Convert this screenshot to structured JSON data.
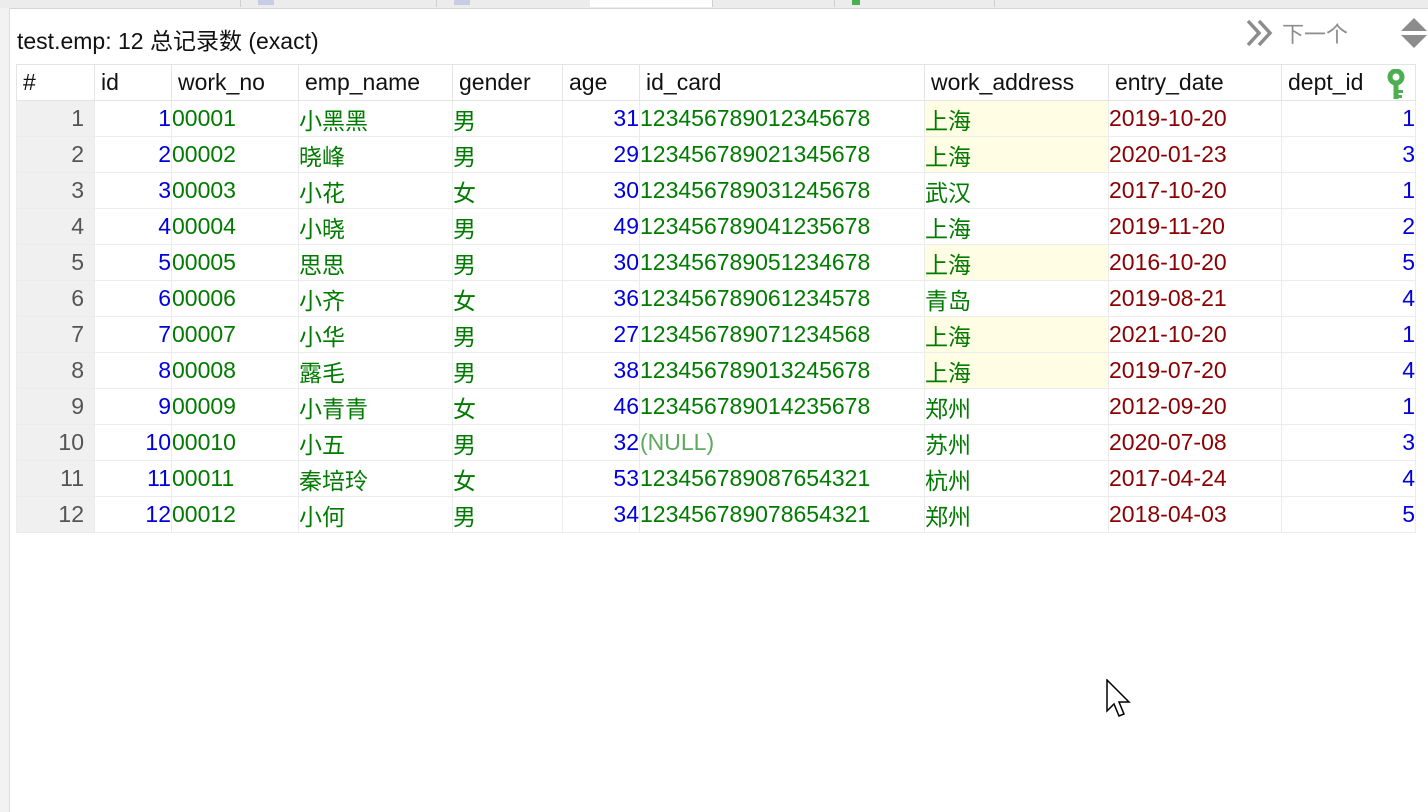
{
  "title": "test.emp: 12 总记录数 (exact)",
  "nav": {
    "next_label": "下一个",
    "next_icon": "double-chevron-right-icon",
    "updown_icon": "scroll-up-down-icon"
  },
  "columns": [
    "#",
    "id",
    "work_no",
    "emp_name",
    "gender",
    "age",
    "id_card",
    "work_address",
    "entry_date",
    "dept_id"
  ],
  "primary_key_icon": "key-icon",
  "colors": {
    "numeric": "#0000dd",
    "text": "#007b00",
    "date": "#8b0000",
    "null": "#5fa85f",
    "highlight": "#fffde3",
    "key": "#4caf50"
  },
  "rows": [
    {
      "n": "1",
      "id": "1",
      "work_no": "00001",
      "emp_name": "小黑黑",
      "gender": "男",
      "age": "31",
      "id_card": "123456789012345678",
      "work_address": "上海",
      "entry_date": "2019-10-20",
      "dept_id": "1"
    },
    {
      "n": "2",
      "id": "2",
      "work_no": "00002",
      "emp_name": "晓峰",
      "gender": "男",
      "age": "29",
      "id_card": "123456789021345678",
      "work_address": "上海",
      "entry_date": "2020-01-23",
      "dept_id": "3"
    },
    {
      "n": "3",
      "id": "3",
      "work_no": "00003",
      "emp_name": "小花",
      "gender": "女",
      "age": "30",
      "id_card": "123456789031245678",
      "work_address": "武汉",
      "entry_date": "2017-10-20",
      "dept_id": "1"
    },
    {
      "n": "4",
      "id": "4",
      "work_no": "00004",
      "emp_name": "小晓",
      "gender": "男",
      "age": "49",
      "id_card": "123456789041235678",
      "work_address": "上海",
      "entry_date": "2019-11-20",
      "dept_id": "2"
    },
    {
      "n": "5",
      "id": "5",
      "work_no": "00005",
      "emp_name": "思思",
      "gender": "男",
      "age": "30",
      "id_card": "123456789051234678",
      "work_address": "上海",
      "entry_date": "2016-10-20",
      "dept_id": "5"
    },
    {
      "n": "6",
      "id": "6",
      "work_no": "00006",
      "emp_name": "小齐",
      "gender": "女",
      "age": "36",
      "id_card": "123456789061234578",
      "work_address": "青岛",
      "entry_date": "2019-08-21",
      "dept_id": "4"
    },
    {
      "n": "7",
      "id": "7",
      "work_no": "00007",
      "emp_name": "小华",
      "gender": "男",
      "age": "27",
      "id_card": "123456789071234568",
      "work_address": "上海",
      "entry_date": "2021-10-20",
      "dept_id": "1"
    },
    {
      "n": "8",
      "id": "8",
      "work_no": "00008",
      "emp_name": "露毛",
      "gender": "男",
      "age": "38",
      "id_card": "123456789013245678",
      "work_address": "上海",
      "entry_date": "2019-07-20",
      "dept_id": "4"
    },
    {
      "n": "9",
      "id": "9",
      "work_no": "00009",
      "emp_name": "小青青",
      "gender": "女",
      "age": "46",
      "id_card": "123456789014235678",
      "work_address": "郑州",
      "entry_date": "2012-09-20",
      "dept_id": "1"
    },
    {
      "n": "10",
      "id": "10",
      "work_no": "00010",
      "emp_name": "小五",
      "gender": "男",
      "age": "32",
      "id_card": "(NULL)",
      "work_address": "苏州",
      "entry_date": "2020-07-08",
      "dept_id": "3"
    },
    {
      "n": "11",
      "id": "11",
      "work_no": "00011",
      "emp_name": "秦培玲",
      "gender": "女",
      "age": "53",
      "id_card": "123456789087654321",
      "work_address": "杭州",
      "entry_date": "2017-04-24",
      "dept_id": "4"
    },
    {
      "n": "12",
      "id": "12",
      "work_no": "00012",
      "emp_name": "小何",
      "gender": "男",
      "age": "34",
      "id_card": "123456789078654321",
      "work_address": "郑州",
      "entry_date": "2018-04-03",
      "dept_id": "5"
    }
  ]
}
